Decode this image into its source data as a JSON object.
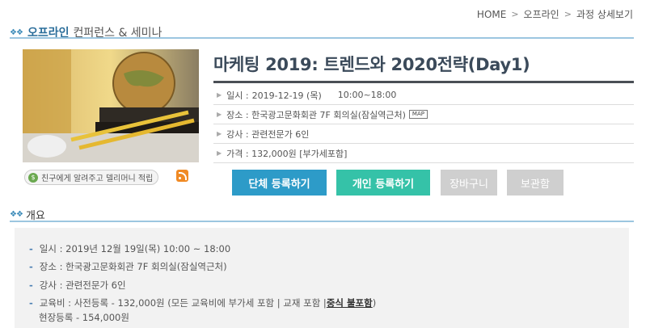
{
  "breadcrumb": [
    "HOME",
    "오프라인",
    "과정 상세보기"
  ],
  "section": {
    "strong": "오프라인",
    "rest": "컨퍼런스 & 세미나"
  },
  "course": {
    "title": "마케팅 2019: 트렌드와 2020전략(Day1)",
    "date_label": "일시 :",
    "date_value": "2019-12-19 (목)",
    "time_value": "10:00~18:00",
    "place": "장소 : 한국광고문화회관 7F 회의실(잠실역근처)",
    "map_label": "MAP",
    "lecturer": "강사 : 관련전문가 6인",
    "price": "가격 : 132,000원 [부가세포함]"
  },
  "share_label": "친구에게 알려주고 델리머니 적립",
  "buttons": {
    "group": "단체 등록하기",
    "personal": "개인 등록하기",
    "cart": "장바구니",
    "keep": "보관함"
  },
  "overview": {
    "title": "개요",
    "date": "일시 : 2019년 12월 19일(목) 10:00 ~ 18:00",
    "place": "장소 : 한국광고문화회관 7F 회의실(잠실역근처)",
    "lecturer": "강사 : 관련전문가 6인",
    "fee_prefix": "교육비 : 사전등록 - 132,000원 (모든 교육비에 부가세 포함 | 교재 포함 | ",
    "fee_bold": "중식 불포함",
    "fee_suffix": ")",
    "fee_onsite": "현장등록 - 154,000원"
  },
  "colors": {
    "accent_blue": "#2d9bc8",
    "accent_teal": "#35c2a8",
    "disabled": "#cfcfcf",
    "title": "#3b4a5a"
  },
  "icons": [
    "chevron-right-icon",
    "share-coin-icon",
    "rss-icon",
    "map-badge"
  ]
}
